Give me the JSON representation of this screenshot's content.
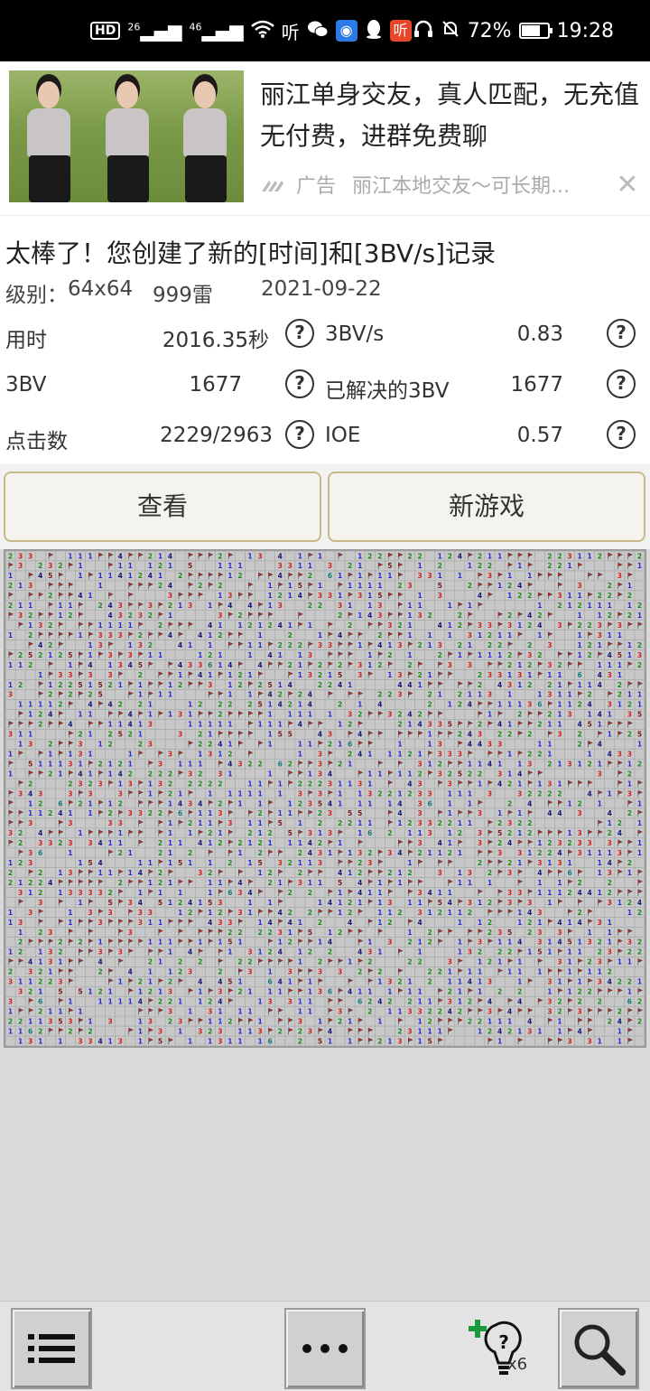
{
  "status_bar": {
    "left_icons": [
      "hd-icon",
      "signal-26-icon",
      "signal-46-icon",
      "wifi-icon",
      "listen-app-icon",
      "wechat-icon",
      "qq-browser-icon",
      "qq-icon",
      "listen-red-icon"
    ],
    "network_1": "26",
    "network_2": "46",
    "battery_percent": "72%",
    "battery_level": 0.72,
    "time": "19:28"
  },
  "ad": {
    "title": "丽江单身交友，真人匹配，无充值无付费，进群免费聊",
    "label": "广告",
    "source": "丽江本地交友～可长期...",
    "close": "✕"
  },
  "results": {
    "headline": "太棒了！您创建了新的[时间]和[3BV/s]记录",
    "level_label": "级别：",
    "level_size": "64x64",
    "mines": "999雷",
    "date": "2021-09-22",
    "stats": [
      {
        "left_label": "用时",
        "left_value": "2016.35秒",
        "right_label": "3BV/s",
        "right_value": "0.83"
      },
      {
        "left_label": "3BV",
        "left_value": "1677",
        "right_label": "已解决的3BV",
        "right_value": "1677"
      },
      {
        "left_label": "点击数",
        "left_value": "2229/2963",
        "right_label": "IOE",
        "right_value": "0.57"
      }
    ],
    "help_glyph": "?"
  },
  "buttons": {
    "view": "查看",
    "new_game": "新游戏"
  },
  "board": {
    "columns": 64,
    "rows": 50,
    "colors": {
      "1": "#2b2bd6",
      "2": "#1d8a1d",
      "3": "#d02020",
      "4": "#15157a",
      "5": "#7a1515",
      "6": "#157a7a",
      "flag": "#d02020"
    }
  },
  "toolbar": {
    "menu_icon": "list-icon",
    "more_icon": "ellipsis-icon",
    "hint_icon": "lightbulb-hint-icon",
    "hint_count": "x6",
    "zoom_icon": "magnifier-icon"
  }
}
